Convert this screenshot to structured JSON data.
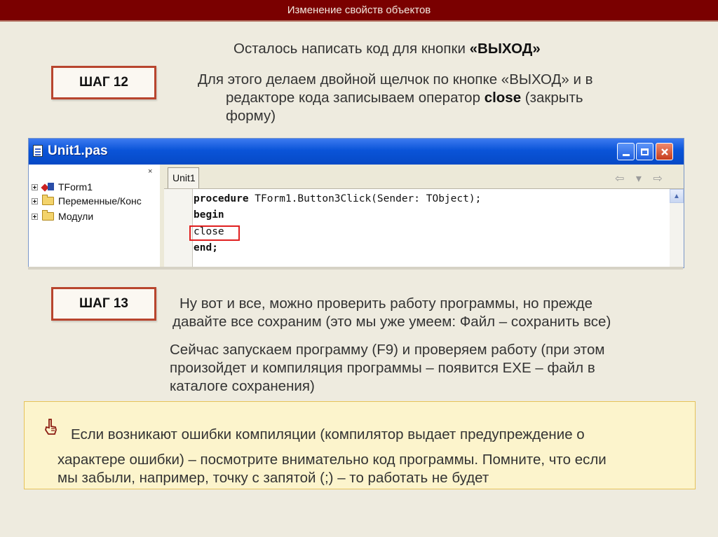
{
  "header": {
    "title": "Изменение свойств объектов"
  },
  "step12": {
    "label": "ШАГ 12",
    "intro": "Осталось написать код для кнопки ",
    "intro_bold": "«ВЫХОД»",
    "line1": "Для этого делаем двойной щелчок по кнопке «ВЫХОД» и в",
    "line2_prefix": "редакторе кода записываем оператор ",
    "line2_bold": "close",
    "line2_suffix": " (закрыть",
    "line3": "форму)"
  },
  "editor": {
    "title": "Unit1.pas",
    "tree_close_glyph": "×",
    "tree_items": [
      {
        "label": "TForm1",
        "icon": "form-icon"
      },
      {
        "label": "Переменные/Конс",
        "icon": "folder-icon"
      },
      {
        "label": "Модули",
        "icon": "folder-icon"
      }
    ],
    "tab_label": "Unit1",
    "nav_glyphs": "⇦ ▾ ⇨ ▾",
    "code": [
      {
        "keyword": "procedure",
        "rest": " TForm1.Button3Click(Sender: TObject);"
      },
      {
        "keyword": "begin",
        "rest": ""
      },
      {
        "keyword": "",
        "rest": "close"
      },
      {
        "keyword": "end;",
        "rest": ""
      }
    ],
    "scroll_up_glyph": "▲"
  },
  "step13": {
    "label": "ШАГ 13",
    "para1_line1": "Ну вот и все, можно проверить работу программы, но прежде",
    "para1_line2": "давайте все сохраним (это мы уже умеем: Файл – сохранить все)",
    "para2_line1": "Сейчас запускаем программу (F9) и проверяем работу (при этом",
    "para2_line2": "произойдет и компиляция программы – появится EXE – файл в",
    "para2_line3": "каталоге сохранения)"
  },
  "hint": {
    "icon": "pointing-hand-icon",
    "line1": "Если возникают ошибки компиляции (компилятор выдает предупреждение о",
    "line2": "характере ошибки) – посмотрите внимательно код программы. Помните, что если",
    "line3": "мы забыли, например, точку с запятой (;) – то работать не будет"
  }
}
